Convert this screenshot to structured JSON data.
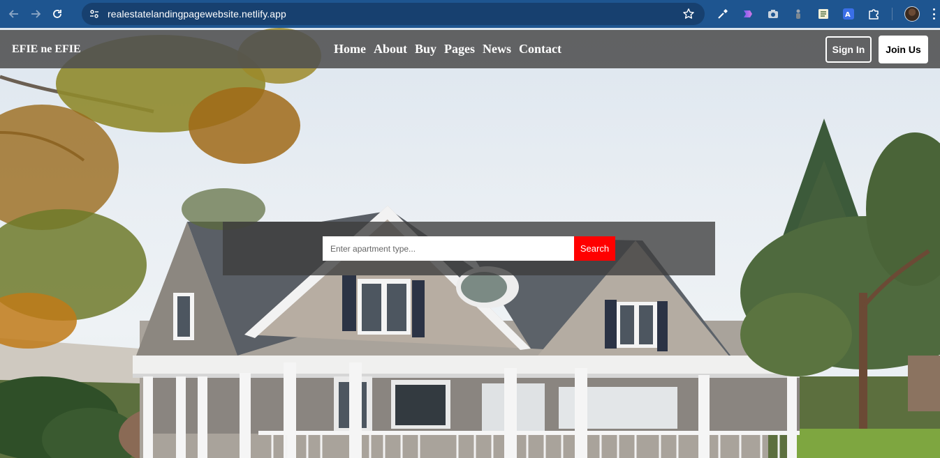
{
  "browser": {
    "url": "realestatelandingpagewebsite.netlify.app",
    "back_icon": "arrow-left-icon",
    "forward_icon": "arrow-right-icon",
    "reload_icon": "reload-icon",
    "site_info_icon": "tune-icon",
    "bookmark_icon": "star-icon",
    "extensions": [
      "eyedropper-icon",
      "gradient-extension-icon",
      "camera-icon",
      "figure-icon",
      "notes-icon",
      "translate-icon",
      "puzzle-icon"
    ],
    "accent": "#1e5590"
  },
  "site": {
    "brand": "EFIE ne EFIE",
    "menu": [
      "Home",
      "About",
      "Buy",
      "Pages",
      "News",
      "Contact"
    ],
    "sign_in": "Sign In",
    "join_us": "Join Us"
  },
  "search": {
    "placeholder": "Enter apartment type...",
    "button": "Search",
    "button_color": "#ff0000"
  }
}
